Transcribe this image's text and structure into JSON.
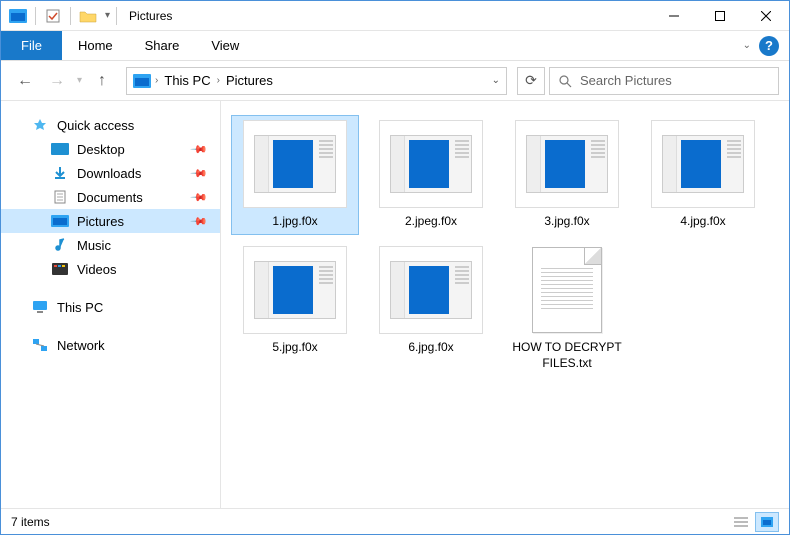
{
  "title": "Pictures",
  "ribbon": {
    "file": "File",
    "tabs": [
      "Home",
      "Share",
      "View"
    ]
  },
  "breadcrumb": {
    "items": [
      "This PC",
      "Pictures"
    ]
  },
  "search": {
    "placeholder": "Search Pictures"
  },
  "sidebar": {
    "quick_access": "Quick access",
    "items": [
      {
        "label": "Desktop",
        "pinned": true,
        "icon": "desktop"
      },
      {
        "label": "Downloads",
        "pinned": true,
        "icon": "downloads"
      },
      {
        "label": "Documents",
        "pinned": true,
        "icon": "documents"
      },
      {
        "label": "Pictures",
        "pinned": true,
        "icon": "pictures",
        "selected": true
      },
      {
        "label": "Music",
        "pinned": false,
        "icon": "music"
      },
      {
        "label": "Videos",
        "pinned": false,
        "icon": "videos"
      }
    ],
    "this_pc": "This PC",
    "network": "Network"
  },
  "files": [
    {
      "name": "1.jpg.f0x",
      "type": "image",
      "selected": true
    },
    {
      "name": "2.jpeg.f0x",
      "type": "image"
    },
    {
      "name": "3.jpg.f0x",
      "type": "image"
    },
    {
      "name": "4.jpg.f0x",
      "type": "image"
    },
    {
      "name": "5.jpg.f0x",
      "type": "image"
    },
    {
      "name": "6.jpg.f0x",
      "type": "image"
    },
    {
      "name": "HOW TO DECRYPT FILES.txt",
      "type": "text"
    }
  ],
  "status": {
    "count": "7 items"
  }
}
